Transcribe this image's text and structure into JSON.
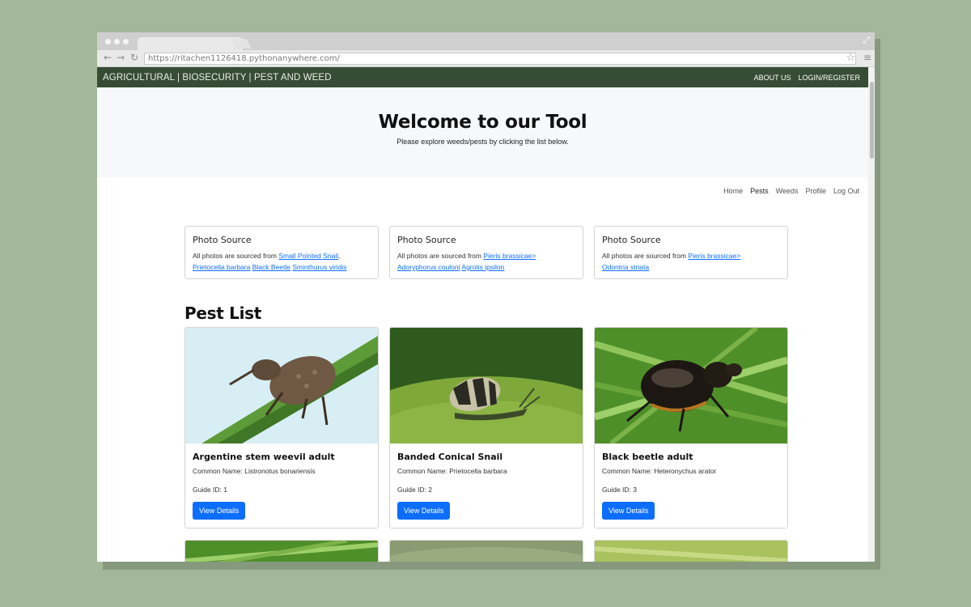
{
  "browser": {
    "url": "https://ritachen1126418.pythonanywhere.com/"
  },
  "topnav": {
    "brand": "AGRICULTURAL | BIOSECURITY | PEST AND WEED",
    "links": [
      "ABOUT US",
      "LOGIN/REGISTER"
    ]
  },
  "hero": {
    "title": "Welcome to our Tool",
    "subtitle": "Please explore weeds/pests by clicking the list below."
  },
  "subnav": [
    "Home",
    "Pests",
    "Weeds",
    "Profile",
    "Log Out"
  ],
  "sources": [
    {
      "title": "Photo Source",
      "prefix": "All photos are sourced from",
      "links": [
        "Small Pointed Snail",
        "Prietocella barbara",
        "Black Beetle",
        "Sminthurus viridis"
      ]
    },
    {
      "title": "Photo Source",
      "prefix": "All photos are sourced from",
      "links": [
        "Pieris brassicae>",
        "Adoryphorus couloni",
        "Agrotis ipsilon"
      ]
    },
    {
      "title": "Photo Source",
      "prefix": "All photos are sourced from",
      "links": [
        "Pieris brassicae>",
        "Odontria striata"
      ]
    }
  ],
  "pest_list": {
    "heading": "Pest List",
    "button_label": "View Details",
    "items": [
      {
        "title": "Argentine stem weevil adult",
        "common": "Common Name: Listronotus bonariensis",
        "guide": "Guide ID: 1"
      },
      {
        "title": "Banded Conical Snail",
        "common": "Common Name: Prietocella barbara",
        "guide": "Guide ID: 2"
      },
      {
        "title": "Black beetle adult",
        "common": "Common Name: Heteronychus arator",
        "guide": "Guide ID: 3"
      }
    ]
  },
  "colors": {
    "navbar": "#364c34",
    "link": "#0d6efd",
    "button": "#0d6efd",
    "page_bg": "#a3b899"
  }
}
